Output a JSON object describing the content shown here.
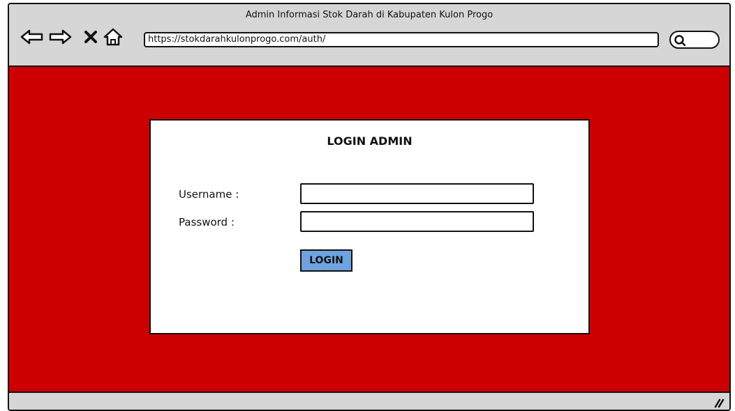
{
  "browser": {
    "window_title": "Admin Informasi Stok Darah di Kabupaten Kulon Progo",
    "url": "https://stokdarahkulonprogo.com/auth/",
    "icons": {
      "back": "arrow-left-icon",
      "forward": "arrow-right-icon",
      "stop": "close-icon",
      "home": "home-icon",
      "search": "search-icon",
      "resize": "resize-grip-icon"
    }
  },
  "page": {
    "background_color": "#cc0000"
  },
  "login": {
    "title": "LOGIN ADMIN",
    "username_label": "Username :",
    "username_value": "",
    "password_label": "Password  :",
    "password_value": "",
    "button_label": "LOGIN",
    "button_color": "#6fa3e0"
  }
}
